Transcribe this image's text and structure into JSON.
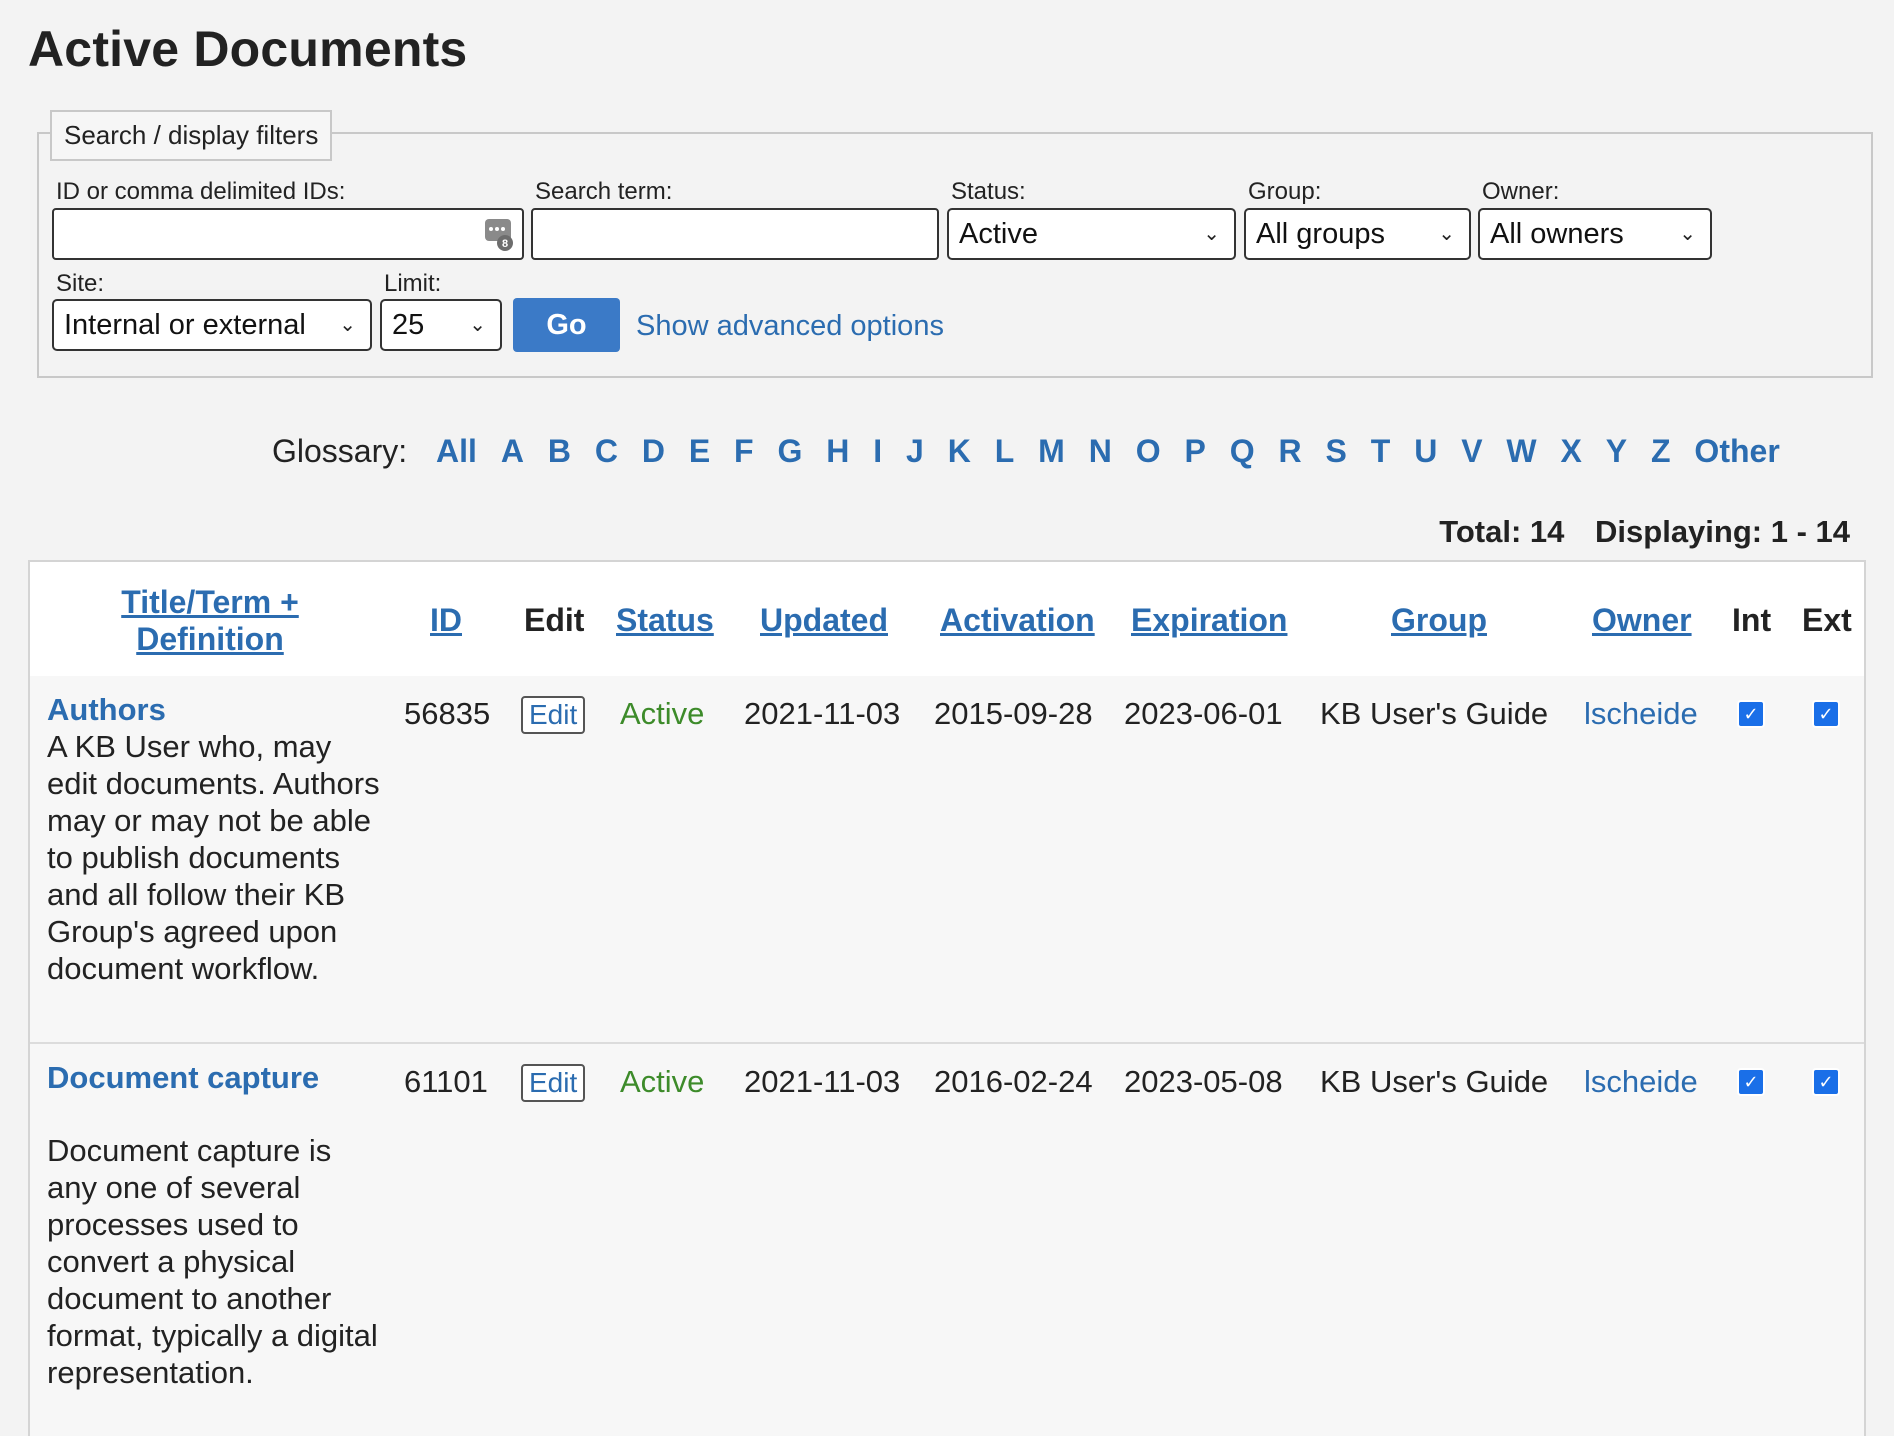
{
  "page": {
    "title": "Active Documents"
  },
  "filters": {
    "legend": "Search / display filters",
    "ids_label": "ID or comma delimited IDs:",
    "ids_value": "",
    "search_label": "Search term:",
    "search_value": "",
    "status_label": "Status:",
    "status_value": "Active",
    "group_label": "Group:",
    "group_value": "All groups",
    "owner_label": "Owner:",
    "owner_value": "All owners",
    "site_label": "Site:",
    "site_value": "Internal or external",
    "limit_label": "Limit:",
    "limit_value": "25",
    "go_label": "Go",
    "advanced_label": "Show advanced options"
  },
  "glossary": {
    "label": "Glossary:",
    "letters": [
      "All",
      "A",
      "B",
      "C",
      "D",
      "E",
      "F",
      "G",
      "H",
      "I",
      "J",
      "K",
      "L",
      "M",
      "N",
      "O",
      "P",
      "Q",
      "R",
      "S",
      "T",
      "U",
      "V",
      "W",
      "X",
      "Y",
      "Z",
      "Other"
    ]
  },
  "totals": {
    "total": "Total: 14",
    "displaying": "Displaying: 1 - 14"
  },
  "table": {
    "headers": {
      "title_line1": "Title/Term +",
      "title_line2": "Definition",
      "id": "ID",
      "edit": "Edit",
      "status": "Status",
      "updated": "Updated",
      "activation": "Activation",
      "expiration": "Expiration",
      "group": "Group",
      "owner": "Owner",
      "int": "Int",
      "ext": "Ext"
    },
    "rows": [
      {
        "title": "Authors",
        "definition": "A KB User who, may edit documents. Authors may or may not be able to publish documents and all follow their KB Group's agreed upon document workflow.",
        "id": "56835",
        "edit": "Edit",
        "status": "Active",
        "updated": "2021-11-03",
        "activation": "2015-09-28",
        "expiration": "2023-06-01",
        "group": "KB User's Guide",
        "owner": "lscheide",
        "int_checked": true,
        "ext_checked": true
      },
      {
        "title": "Document capture",
        "definition": "Document capture is any one of several processes used to convert a physical document to another format, typically a digital representation.",
        "id": "61101",
        "edit": "Edit",
        "status": "Active",
        "updated": "2021-11-03",
        "activation": "2016-02-24",
        "expiration": "2023-05-08",
        "group": "KB User's Guide",
        "owner": "lscheide",
        "int_checked": true,
        "ext_checked": true
      }
    ]
  },
  "colors": {
    "link": "#2b6cb0",
    "int_col": "#3b78d0",
    "ext_col": "#8b1b13",
    "status_active": "#3d8b2a",
    "go_button": "#3b7ac7"
  }
}
